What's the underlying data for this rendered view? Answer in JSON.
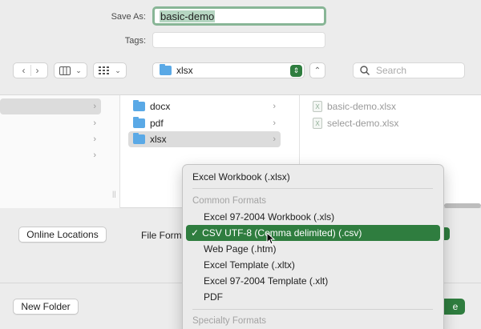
{
  "save_as": {
    "label": "Save As:",
    "value": "basic-demo"
  },
  "tags": {
    "label": "Tags:",
    "value": ""
  },
  "toolbar": {
    "location": "xlsx",
    "search_placeholder": "Search"
  },
  "columns": {
    "folders": [
      "docx",
      "pdf",
      "xlsx"
    ],
    "files": [
      "basic-demo.xlsx",
      "select-demo.xlsx"
    ]
  },
  "bottom": {
    "online_locations": "Online Locations",
    "file_format_label": "File Form",
    "new_folder": "New Folder",
    "save_partial": "e"
  },
  "format_menu": {
    "top_item": "Excel Workbook (.xlsx)",
    "common_header": "Common Formats",
    "items": [
      "Excel 97-2004 Workbook (.xls)",
      "CSV UTF-8 (Comma delimited) (.csv)",
      "Web Page (.htm)",
      "Excel Template (.xltx)",
      "Excel 97-2004 Template (.xlt)",
      "PDF"
    ],
    "selected_check": "✓",
    "specialty_header": "Specialty Formats"
  },
  "colors": {
    "accent": "#2f7d3f",
    "folder": "#5aa9e6"
  }
}
